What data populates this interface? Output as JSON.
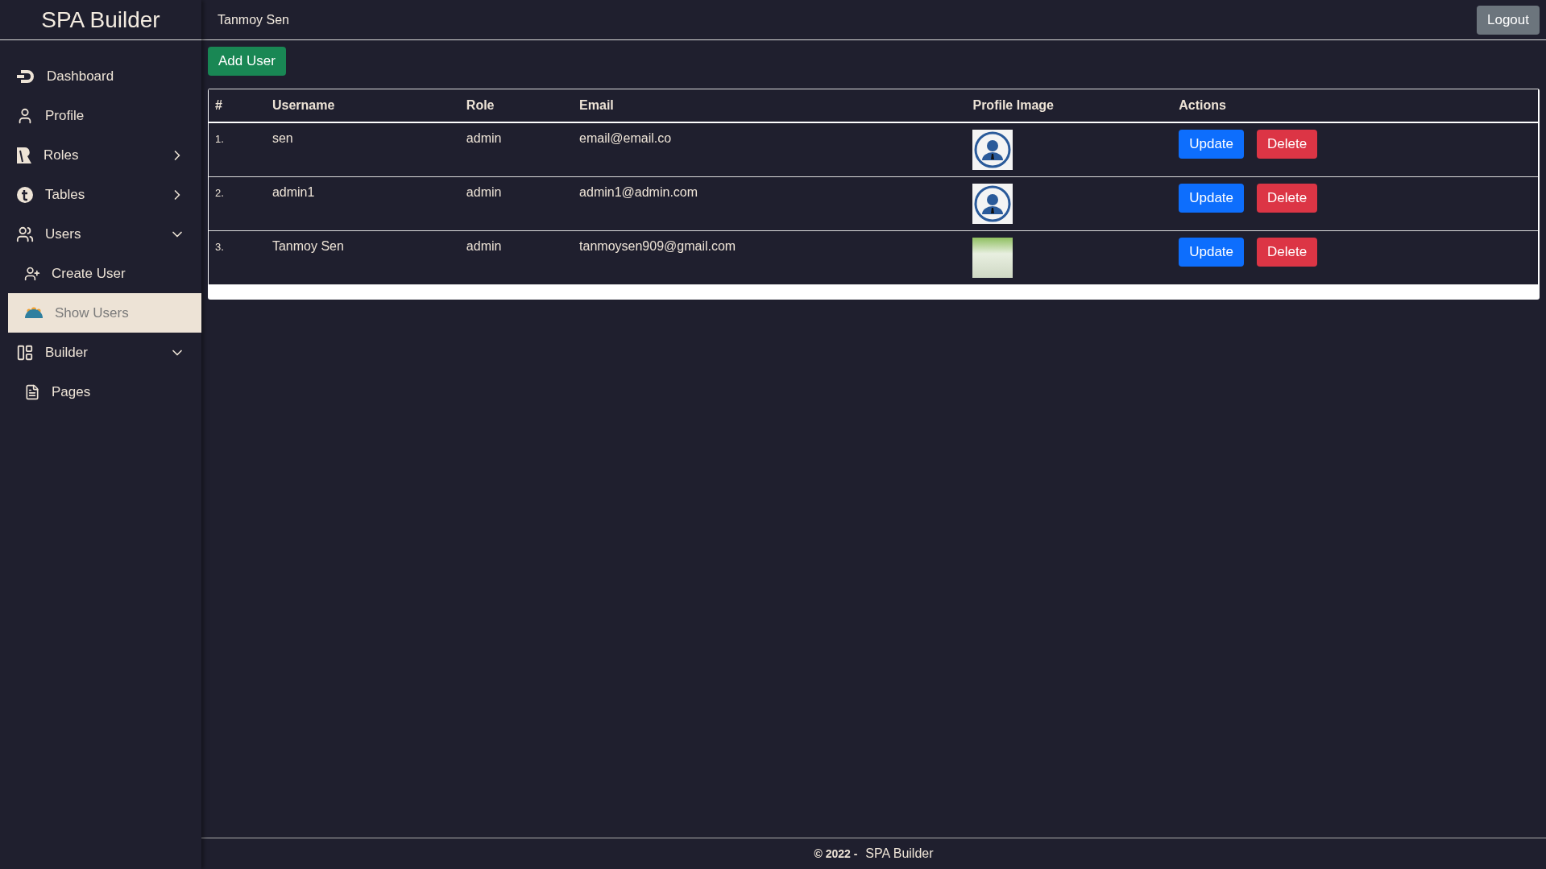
{
  "sidebar": {
    "brand": "SPA Builder",
    "items": [
      {
        "label": "Dashboard",
        "selected": false
      },
      {
        "label": "Profile",
        "selected": false
      },
      {
        "label": "Roles",
        "selected": false,
        "expanded": false
      },
      {
        "label": "Tables",
        "selected": false,
        "expanded": false
      },
      {
        "label": "Users",
        "selected": false,
        "expanded": true,
        "children": [
          {
            "label": "Create User",
            "selected": false
          },
          {
            "label": "Show Users",
            "selected": true
          }
        ]
      },
      {
        "label": "Builder",
        "selected": false,
        "expanded": true,
        "children": [
          {
            "label": "Pages",
            "selected": false
          }
        ]
      }
    ]
  },
  "topbar": {
    "user": "Tanmoy Sen",
    "logout": "Logout"
  },
  "add_button": "Add User",
  "table": {
    "columns": [
      "#",
      "Username",
      "Role",
      "Email",
      "Profile Image",
      "Actions"
    ],
    "rows": [
      {
        "index": "1.",
        "username": "sen",
        "role": "admin",
        "email": "email@email.co",
        "image": {
          "kind": "avatar"
        },
        "actions": [
          "Update",
          "Delete"
        ]
      },
      {
        "index": "2.",
        "username": "admin1",
        "role": "admin",
        "email": "admin1@admin.com",
        "image": {
          "kind": "avatar"
        },
        "actions": [
          "Update",
          "Delete"
        ]
      },
      {
        "index": "3.",
        "username": "Tanmoy Sen",
        "role": "admin",
        "email": "tanmoysen909@gmail.com",
        "image": {
          "kind": "photo"
        },
        "actions": [
          "Update",
          "Delete"
        ]
      }
    ]
  },
  "footer": {
    "copyright": "© 2022 -",
    "brand": "SPA Builder"
  }
}
